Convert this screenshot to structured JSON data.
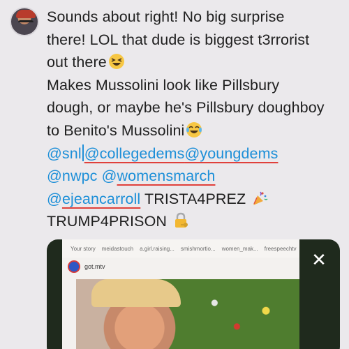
{
  "post": {
    "line1": "Sounds about right! No big surprise",
    "line2": "there! LOL that dude is biggest t3rrorist",
    "line3": "out there",
    "line4": "Makes Mussolini look like Pillsbury",
    "line5": "dough, or maybe he's Pillsbury doughboy",
    "line6": "to Benito's Mussolini",
    "mention_snl": "@snl",
    "mention_collegedems": "@collegedems",
    "mention_youngdems": "@youngdems",
    "mention_nwpc": "@nwpc",
    "mention_womensmarch_at": "@",
    "mention_womensmarch": "womensmarch",
    "mention_ejeancarroll_at": "@",
    "mention_ejeancarroll": "ejeancarroll",
    "trista": "TRISTA4PREZ",
    "trump": "TRUMP4PRISON"
  },
  "media": {
    "stories": [
      "Your story",
      "meidastouch",
      "a.girl.raising...",
      "smishmortio...",
      "women_mak...",
      "freespeechtv"
    ],
    "account": "got.mtv",
    "close_label": "✕"
  },
  "icons": {
    "avatar": "profile-avatar",
    "laugh_squint": "grinning-squinting-face-icon",
    "laugh_tears": "face-with-tears-of-joy-icon",
    "party": "party-popper-icon",
    "lock": "locked-with-key-icon",
    "close": "close-icon"
  },
  "colors": {
    "mention": "#1d8fd8",
    "spellcheck": "#e0403b",
    "background": "#ebe9ec"
  }
}
